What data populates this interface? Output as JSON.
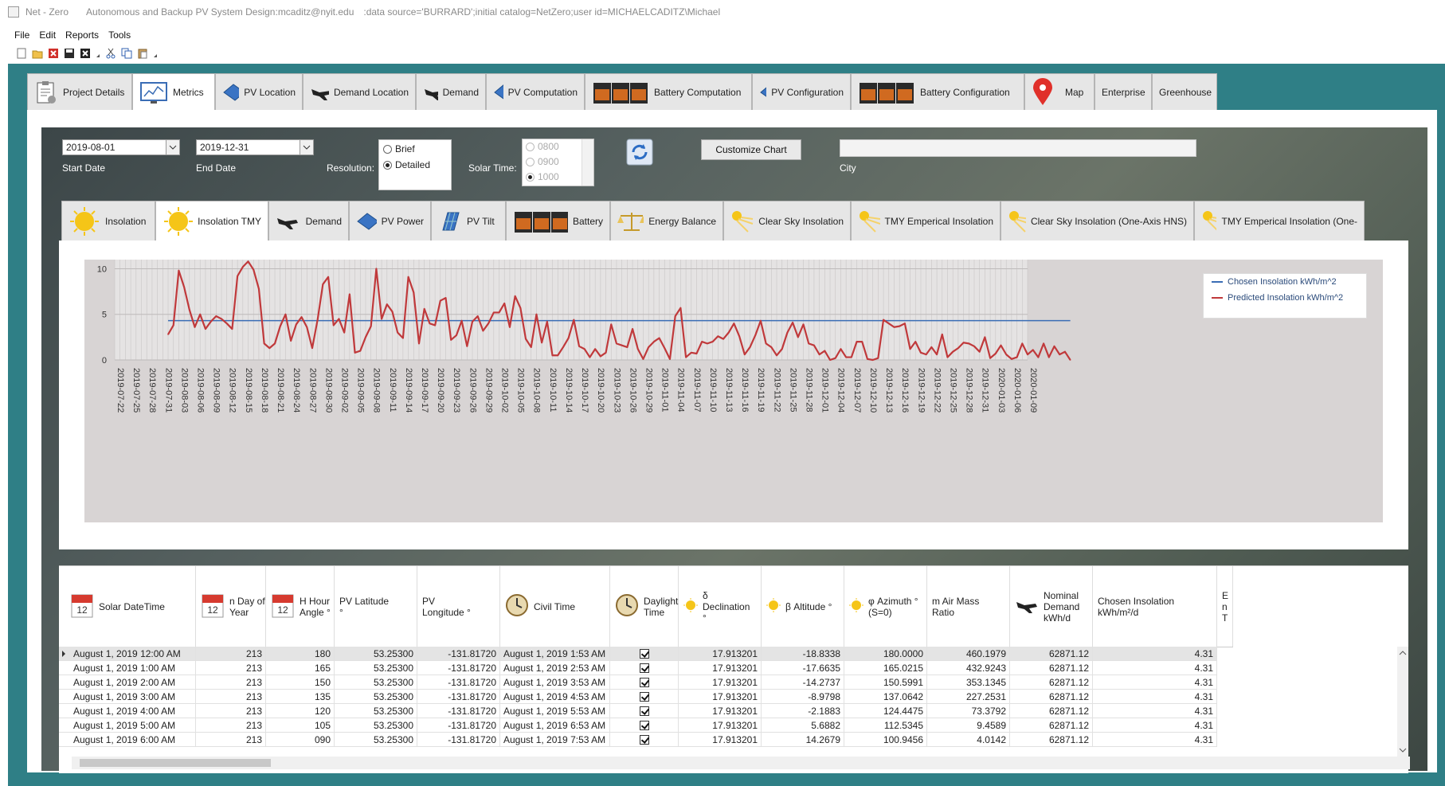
{
  "window": {
    "app_name": "Net - Zero",
    "subtitle": "Autonomous and Backup PV System Design:mcaditz@nyit.edu",
    "connection": ":data source='BURRARD';initial catalog=NetZero;user id=MICHAELCADITZ\\Michael"
  },
  "menu": [
    "File",
    "Edit",
    "Reports",
    "Tools"
  ],
  "top_tabs": [
    {
      "label": "Project Details",
      "icon": "clipboard-gear-icon"
    },
    {
      "label": "Metrics",
      "icon": "chart-monitor-icon",
      "active": true
    },
    {
      "label": "PV Location",
      "icon": "solar-panel-icon"
    },
    {
      "label": "Demand Location",
      "icon": "jet-icon"
    },
    {
      "label": "Demand",
      "icon": "jet-icon"
    },
    {
      "label": "PV Computation",
      "icon": "solar-panel-icon"
    },
    {
      "label": "Battery Computation",
      "icon": "battery-icon"
    },
    {
      "label": "PV Configuration",
      "icon": "solar-panel-icon"
    },
    {
      "label": "Battery Configuration",
      "icon": "battery-icon"
    },
    {
      "label": "Map",
      "icon": "map-pin-icon"
    },
    {
      "label": "Enterprise",
      "icon": ""
    },
    {
      "label": "Greenhouse",
      "icon": ""
    }
  ],
  "controls": {
    "start_date": "2019-08-01",
    "start_label": "Start Date",
    "end_date": "2019-12-31",
    "end_label": "End Date",
    "resolution_label": "Resolution:",
    "resolution_options": [
      "Brief",
      "Detailed"
    ],
    "resolution_selected": "Detailed",
    "solar_time_label": "Solar Time:",
    "solar_time_options": [
      "0800",
      "0900",
      "1000"
    ],
    "solar_time_selected": "1000",
    "customize_label": "Customize Chart",
    "city_label": "City",
    "city_value": ""
  },
  "inner_tabs": [
    {
      "label": "Insolation",
      "icon": "sun-icon"
    },
    {
      "label": "Insolation TMY",
      "icon": "sun-icon",
      "active": true
    },
    {
      "label": "Demand",
      "icon": "jet-icon"
    },
    {
      "label": "PV Power",
      "icon": "solar-panel-icon"
    },
    {
      "label": "PV Tilt",
      "icon": "solar-panel-tilt-icon"
    },
    {
      "label": "Battery",
      "icon": "battery-icon"
    },
    {
      "label": "Energy Balance",
      "icon": "scale-icon"
    },
    {
      "label": "Clear Sky Insolation",
      "icon": "sun-rays-icon"
    },
    {
      "label": "TMY Emperical Insolation",
      "icon": "sun-rays-icon"
    },
    {
      "label": "Clear Sky Insolation (One-Axis HNS)",
      "icon": "sun-rays-icon"
    },
    {
      "label": "TMY Emperical Insolation (One-",
      "icon": "sun-rays-icon"
    }
  ],
  "chart_data": {
    "type": "line",
    "x_tick_labels": [
      "2019-07-22",
      "2019-07-25",
      "2019-07-28",
      "2019-07-31",
      "2019-08-03",
      "2019-08-06",
      "2019-08-09",
      "2019-08-12",
      "2019-08-15",
      "2019-08-18",
      "2019-08-21",
      "2019-08-24",
      "2019-08-27",
      "2019-08-30",
      "2019-09-02",
      "2019-09-05",
      "2019-09-08",
      "2019-09-11",
      "2019-09-14",
      "2019-09-17",
      "2019-09-20",
      "2019-09-23",
      "2019-09-26",
      "2019-09-29",
      "2019-10-02",
      "2019-10-05",
      "2019-10-08",
      "2019-10-11",
      "2019-10-14",
      "2019-10-17",
      "2019-10-20",
      "2019-10-23",
      "2019-10-26",
      "2019-10-29",
      "2019-11-01",
      "2019-11-04",
      "2019-11-07",
      "2019-11-10",
      "2019-11-13",
      "2019-11-16",
      "2019-11-19",
      "2019-11-22",
      "2019-11-25",
      "2019-11-28",
      "2019-12-01",
      "2019-12-04",
      "2019-12-07",
      "2019-12-10",
      "2019-12-13",
      "2019-12-16",
      "2019-12-19",
      "2019-12-22",
      "2019-12-25",
      "2019-12-28",
      "2019-12-31",
      "2020-01-03",
      "2020-01-06",
      "2020-01-09"
    ],
    "y_ticks": [
      0,
      5,
      10
    ],
    "ylim": [
      0,
      11
    ],
    "x_start": "2019-08-01",
    "x_step_days": 1,
    "series": [
      {
        "name": "Chosen Insolation kWh/m^2",
        "color": "#3a6db5",
        "constant": 4.31
      },
      {
        "name": "Predicted Insolation kWh/m^2",
        "color": "#c0393b",
        "values": [
          2.8,
          3.8,
          9.8,
          8.0,
          5.5,
          3.6,
          5.0,
          3.4,
          4.2,
          4.8,
          4.5,
          4.0,
          3.4,
          9.2,
          10.2,
          10.8,
          9.9,
          7.8,
          1.8,
          1.3,
          1.8,
          3.7,
          5.0,
          2.1,
          3.9,
          4.7,
          3.6,
          1.3,
          4.4,
          8.3,
          9.1,
          3.8,
          4.5,
          3.0,
          7.2,
          0.8,
          1.0,
          2.5,
          3.7,
          10.0,
          4.5,
          6.1,
          5.3,
          3.0,
          2.4,
          9.1,
          7.4,
          1.8,
          5.6,
          4.0,
          3.8,
          6.5,
          6.8,
          2.2,
          2.7,
          4.3,
          1.5,
          4.2,
          4.8,
          3.2,
          4.0,
          5.2,
          5.2,
          6.2,
          3.6,
          7.0,
          5.7,
          2.3,
          1.4,
          5.0,
          1.9,
          4.2,
          0.5,
          0.5,
          1.4,
          2.4,
          4.4,
          1.5,
          1.2,
          0.3,
          1.2,
          0.4,
          0.8,
          3.9,
          1.8,
          1.6,
          1.4,
          3.4,
          1.2,
          0.1,
          1.4,
          2.0,
          2.4,
          1.3,
          0.1,
          4.8,
          5.7,
          0.3,
          0.8,
          0.7,
          2.0,
          1.8,
          2.0,
          2.6,
          2.3,
          3.0,
          4.0,
          2.6,
          0.6,
          1.4,
          2.7,
          4.3,
          1.8,
          1.4,
          0.5,
          1.2,
          3.0,
          4.1,
          2.5,
          3.9,
          1.8,
          1.6,
          0.6,
          1.0,
          0.0,
          0.2,
          1.2,
          0.3,
          0.3,
          2.0,
          2.0,
          0.1,
          0.0,
          0.2,
          4.4,
          4.0,
          3.6,
          3.7,
          4.0,
          1.2,
          2.0,
          0.8,
          0.6,
          1.4,
          0.6,
          2.8,
          0.3,
          0.9,
          1.3,
          1.9,
          1.8,
          1.5,
          0.9,
          2.5,
          0.2,
          0.7,
          1.6,
          0.6,
          0.1,
          0.3,
          1.8,
          0.6,
          1.1,
          0.3,
          1.8,
          0.3,
          1.5,
          0.6,
          0.9,
          0.0
        ]
      }
    ]
  },
  "table": {
    "headers": [
      {
        "label": "Solar DateTime",
        "icon": "calendar-icon"
      },
      {
        "label": "n Day of Year",
        "icon": "calendar-icon"
      },
      {
        "label": "H Hour Angle °",
        "icon": "calendar-icon"
      },
      {
        "label": "PV Latitude °",
        "icon": ""
      },
      {
        "label": "PV Longitude °",
        "icon": ""
      },
      {
        "label": "Civil Time",
        "icon": "clock-icon"
      },
      {
        "label": "Daylight Time",
        "icon": "clock-icon"
      },
      {
        "label": "δ Declination °",
        "icon": "sun-icon"
      },
      {
        "label": "β Altitude °",
        "icon": "sun-icon"
      },
      {
        "label": "φ Azimuth ° (S=0)",
        "icon": "sun-icon"
      },
      {
        "label": "m Air Mass Ratio",
        "icon": ""
      },
      {
        "label": "Nominal Demand kWh/d",
        "icon": "jet-icon"
      },
      {
        "label": "Chosen Insolation kWh/m²/d",
        "icon": ""
      },
      {
        "label": "E n T",
        "icon": ""
      }
    ],
    "rows": [
      [
        "August 1, 2019 12:00 AM",
        "213",
        "180",
        "53.25300",
        "-131.81720",
        "August 1, 2019 1:53 AM",
        "✓",
        "17.913201",
        "-18.8338",
        "180.0000",
        "460.1979",
        "62871.12",
        "4.31"
      ],
      [
        "August 1, 2019 1:00 AM",
        "213",
        "165",
        "53.25300",
        "-131.81720",
        "August 1, 2019 2:53 AM",
        "✓",
        "17.913201",
        "-17.6635",
        "165.0215",
        "432.9243",
        "62871.12",
        "4.31"
      ],
      [
        "August 1, 2019 2:00 AM",
        "213",
        "150",
        "53.25300",
        "-131.81720",
        "August 1, 2019 3:53 AM",
        "✓",
        "17.913201",
        "-14.2737",
        "150.5991",
        "353.1345",
        "62871.12",
        "4.31"
      ],
      [
        "August 1, 2019 3:00 AM",
        "213",
        "135",
        "53.25300",
        "-131.81720",
        "August 1, 2019 4:53 AM",
        "✓",
        "17.913201",
        "-8.9798",
        "137.0642",
        "227.2531",
        "62871.12",
        "4.31"
      ],
      [
        "August 1, 2019 4:00 AM",
        "213",
        "120",
        "53.25300",
        "-131.81720",
        "August 1, 2019 5:53 AM",
        "✓",
        "17.913201",
        "-2.1883",
        "124.4475",
        "73.3792",
        "62871.12",
        "4.31"
      ],
      [
        "August 1, 2019 5:00 AM",
        "213",
        "105",
        "53.25300",
        "-131.81720",
        "August 1, 2019 6:53 AM",
        "✓",
        "17.913201",
        "5.6882",
        "112.5345",
        "9.4589",
        "62871.12",
        "4.31"
      ],
      [
        "August 1, 2019 6:00 AM",
        "213",
        "090",
        "53.25300",
        "-131.81720",
        "August 1, 2019 7:53 AM",
        "✓",
        "17.913201",
        "14.2679",
        "100.9456",
        "4.0142",
        "62871.12",
        "4.31"
      ]
    ]
  }
}
